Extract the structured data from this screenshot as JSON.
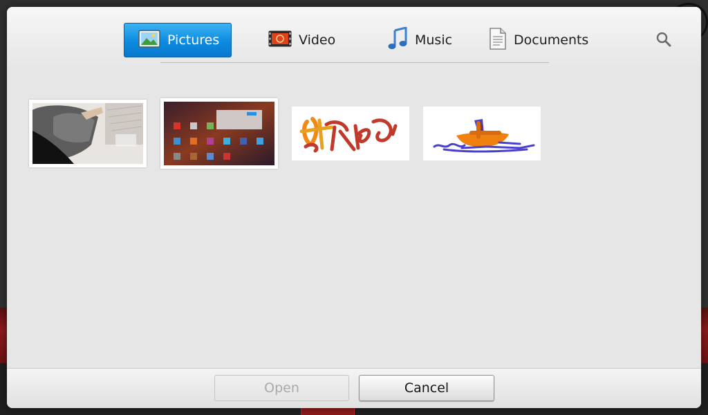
{
  "dialog": {
    "tabs": [
      {
        "label": "Pictures",
        "icon": "pictures-icon",
        "active": true
      },
      {
        "label": "Video",
        "icon": "video-film-icon",
        "active": false
      },
      {
        "label": "Music",
        "icon": "music-note-icon",
        "active": false
      },
      {
        "label": "Documents",
        "icon": "document-icon",
        "active": false
      }
    ],
    "search_icon": "search-icon",
    "thumbnails": [
      {
        "kind": "photo"
      },
      {
        "kind": "screenshot"
      },
      {
        "kind": "drawing"
      },
      {
        "kind": "drawing"
      }
    ],
    "buttons": {
      "open_label": "Open",
      "cancel_label": "Cancel"
    }
  },
  "colors": {
    "active_tab": "#0c8be0",
    "dialog_bg": "#e6e6e6",
    "disabled_text": "#a9a9a9"
  }
}
